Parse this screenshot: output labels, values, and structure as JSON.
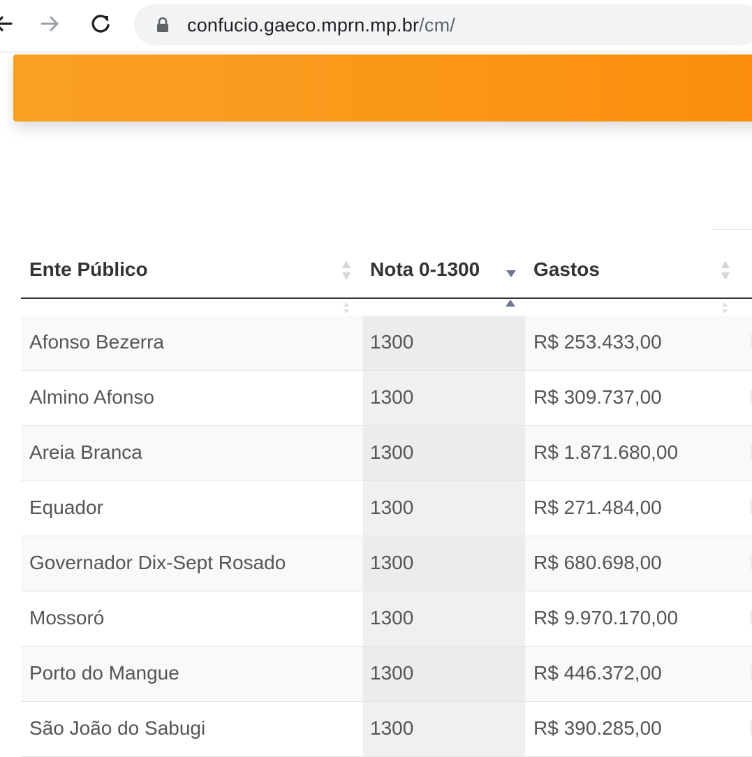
{
  "browser": {
    "url_host": "confucio.gaeco.mprn.mp.br",
    "url_path": "/cm/",
    "icons": [
      "back-arrow-icon",
      "forward-arrow-icon",
      "reload-icon",
      "lock-icon"
    ]
  },
  "banner": {
    "color": "#fb9617"
  },
  "table": {
    "columns": [
      "Ente Público",
      "Nota 0-1300",
      "Gastos",
      ""
    ],
    "sort": {
      "column": "Nota 0-1300",
      "direction": "desc"
    },
    "rows": [
      {
        "ente": "Afonso Bezerra",
        "nota": "1300",
        "gastos": "R$ 253.433,00"
      },
      {
        "ente": "Almino Afonso",
        "nota": "1300",
        "gastos": "R$ 309.737,00"
      },
      {
        "ente": "Areia Branca",
        "nota": "1300",
        "gastos": "R$ 1.871.680,00"
      },
      {
        "ente": "Equador",
        "nota": "1300",
        "gastos": "R$ 271.484,00"
      },
      {
        "ente": "Governador Dix-Sept Rosado",
        "nota": "1300",
        "gastos": "R$ 680.698,00"
      },
      {
        "ente": "Mossoró",
        "nota": "1300",
        "gastos": "R$ 9.970.170,00"
      },
      {
        "ente": "Porto do Mangue",
        "nota": "1300",
        "gastos": "R$ 446.372,00"
      },
      {
        "ente": "São João do Sabugi",
        "nota": "1300",
        "gastos": "R$ 390.285,00"
      }
    ]
  }
}
